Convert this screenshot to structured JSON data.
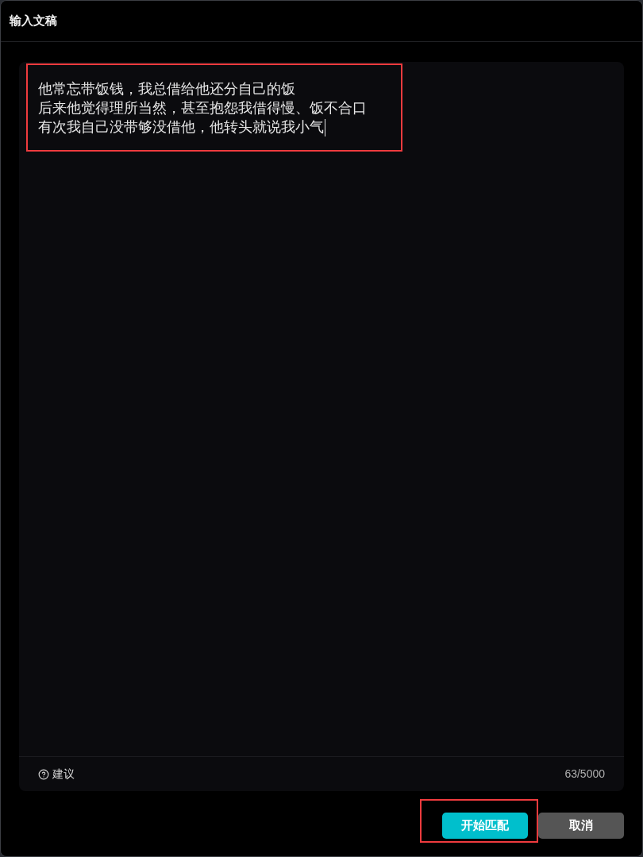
{
  "dialog": {
    "title": "输入文稿"
  },
  "editor": {
    "lines": [
      "他常忘带饭钱，我总借给他还分自己的饭",
      "后来他觉得理所当然，甚至抱怨我借得慢、饭不合口",
      "有次我自己没带够没借他，他转头就说我小气"
    ],
    "focused": true,
    "highlighted": true
  },
  "footer": {
    "hint": "建议",
    "count": "63/5000"
  },
  "buttons": [
    {
      "label": "开始匹配",
      "kind": "primary",
      "highlighted": true
    },
    {
      "label": "取消",
      "kind": "secondary",
      "highlighted": false
    }
  ]
}
